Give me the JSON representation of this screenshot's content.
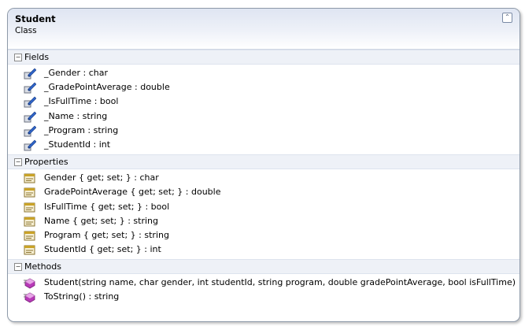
{
  "class": {
    "name": "Student",
    "stereotype": "Class"
  },
  "sections": {
    "fields": {
      "label": "Fields",
      "items": [
        "_Gender : char",
        "_GradePointAverage : double",
        "_IsFullTime : bool",
        "_Name : string",
        "_Program : string",
        "_StudentId : int"
      ]
    },
    "properties": {
      "label": "Properties",
      "items": [
        "Gender { get; set; } : char",
        "GradePointAverage { get; set; } : double",
        "IsFullTime { get; set; } : bool",
        "Name { get; set; } : string",
        "Program { get; set; } : string",
        "StudentId { get; set; } : int"
      ]
    },
    "methods": {
      "label": "Methods",
      "items": [
        "Student(string name, char gender, int studentId, string program, double gradePointAverage, bool isFullTime)",
        "ToString() : string"
      ]
    }
  },
  "icons": {
    "collapse": "double-chevron-up-icon",
    "section_toggle": "minus-box-icon",
    "field": "field-icon",
    "property": "property-icon",
    "method": "method-icon"
  },
  "colors": {
    "header_gradient_top": "#dfe5f2",
    "border": "#8e9aa9",
    "field_icon": "#2f64c8",
    "property_icon": "#c9a227",
    "method_icon": "#b83ab8"
  }
}
